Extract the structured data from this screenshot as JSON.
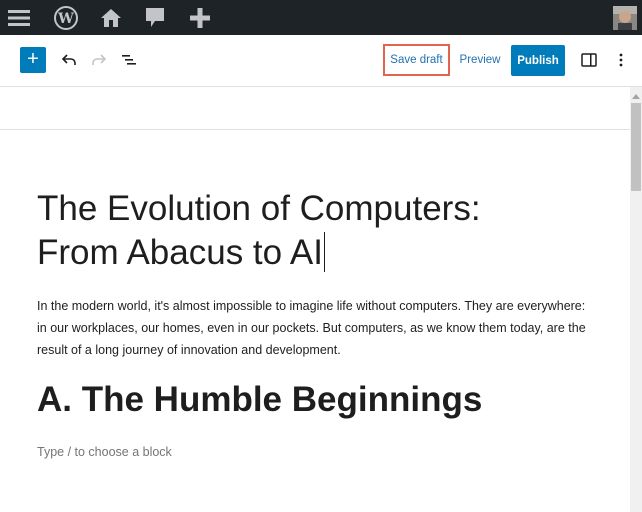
{
  "admin_bar": {
    "icons": [
      "menu-icon",
      "wordpress-logo-icon",
      "home-icon",
      "comments-icon",
      "new-content-icon"
    ],
    "avatar": "user-avatar"
  },
  "toolbar": {
    "inserter_label": "+",
    "undo": "undo-icon",
    "redo": "redo-icon",
    "list_view": "list-view-icon",
    "save_draft_label": "Save draft",
    "preview_label": "Preview",
    "publish_label": "Publish",
    "settings": "sidebar-toggle-icon",
    "options": "more-options-icon",
    "highlight_color": "#e0644e",
    "accent_color": "#007cba"
  },
  "post": {
    "title_line1": "The Evolution of Computers:",
    "title_line2": "From Abacus to AI",
    "paragraph": "In the modern world, it's almost impossible to imagine life without computers. They are everywhere: in our workplaces, our homes, even in our pockets. But computers, as we know them today, are the result of a long journey of innovation and development.",
    "heading": "A. The Humble Beginnings",
    "block_placeholder": "Type / to choose a block"
  }
}
